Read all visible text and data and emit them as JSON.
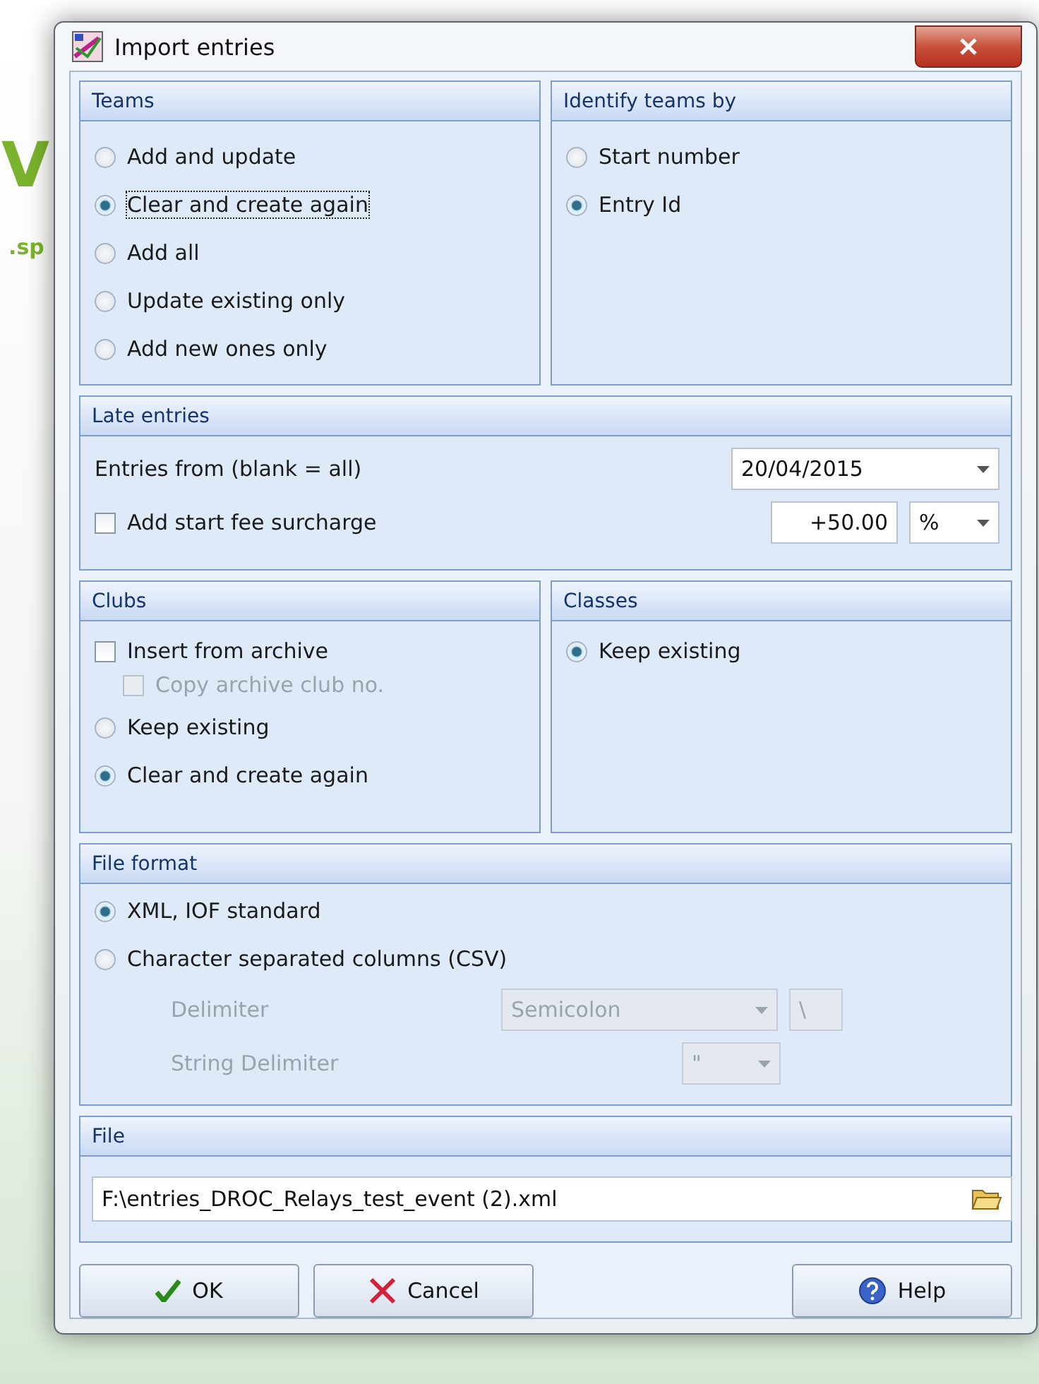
{
  "background": {
    "logo_letter": "V",
    "text": ".sp"
  },
  "window": {
    "title": "Import entries"
  },
  "teams": {
    "title": "Teams",
    "options": [
      {
        "label": "Add and update",
        "selected": false,
        "focused": false
      },
      {
        "label": "Clear and create again",
        "selected": true,
        "focused": true
      },
      {
        "label": "Add all",
        "selected": false,
        "focused": false
      },
      {
        "label": "Update existing only",
        "selected": false,
        "focused": false
      },
      {
        "label": "Add new ones only",
        "selected": false,
        "focused": false
      }
    ]
  },
  "identify": {
    "title": "Identify teams by",
    "options": [
      {
        "label": "Start number",
        "selected": false
      },
      {
        "label": "Entry Id",
        "selected": true
      }
    ]
  },
  "late_entries": {
    "title": "Late entries",
    "entries_from": {
      "label": "Entries from (blank = all)",
      "value": "20/04/2015"
    },
    "surcharge": {
      "label": "Add start fee surcharge",
      "checked": false,
      "value": "+50.00",
      "unit": "%"
    }
  },
  "clubs": {
    "title": "Clubs",
    "items": [
      {
        "kind": "checkbox",
        "label": "Insert from archive",
        "checked": false,
        "disabled": false,
        "children": [
          {
            "kind": "checkbox",
            "label": "Copy archive club no.",
            "checked": false,
            "disabled": true
          }
        ]
      },
      {
        "kind": "radio",
        "label": "Keep existing",
        "selected": false,
        "disabled": false
      },
      {
        "kind": "radio",
        "label": "Clear and create again",
        "selected": true,
        "disabled": false
      }
    ]
  },
  "classes": {
    "title": "Classes",
    "options": [
      {
        "label": "Keep existing",
        "selected": true
      }
    ]
  },
  "file_format": {
    "title": "File format",
    "options": [
      {
        "label": "XML, IOF standard",
        "selected": true
      },
      {
        "label": "Character separated columns (CSV)",
        "selected": false
      }
    ],
    "delimiter": {
      "label": "Delimiter",
      "value": "Semicolon",
      "custom": "\\",
      "disabled": true
    },
    "string_delimiter": {
      "label": "String Delimiter",
      "value": "\"",
      "disabled": true
    }
  },
  "file": {
    "title": "File",
    "path": "F:\\entries_DROC_Relays_test_event (2).xml"
  },
  "buttons": [
    {
      "kind": "ok",
      "label": "OK"
    },
    {
      "kind": "cancel",
      "label": "Cancel"
    },
    {
      "kind": "help",
      "label": "Help"
    }
  ]
}
